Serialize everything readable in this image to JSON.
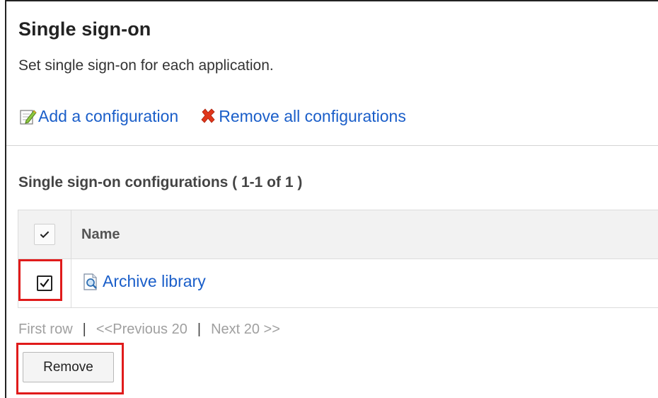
{
  "page": {
    "title": "Single sign-on",
    "description": "Set single sign-on for each application."
  },
  "actions": {
    "add_label": "Add a configuration",
    "add_icon": "edit-icon",
    "remove_all_label": "Remove all configurations",
    "remove_all_icon": "x-icon"
  },
  "list": {
    "title": "Single sign-on configurations ( 1-1 of 1 )",
    "columns": {
      "name": "Name"
    },
    "header_checkbox_checked": true,
    "rows": [
      {
        "name": "Archive library",
        "icon": "document-search-icon",
        "checked": true
      }
    ]
  },
  "pager": {
    "first": "First row",
    "separator": "|",
    "previous": "<<Previous 20",
    "next": "Next 20 >>"
  },
  "buttons": {
    "remove": "Remove"
  },
  "colors": {
    "link": "#1a5ec9",
    "highlight": "#e01b1b",
    "header_bg": "#f2f2f2",
    "disabled_text": "#a0a0a0"
  }
}
